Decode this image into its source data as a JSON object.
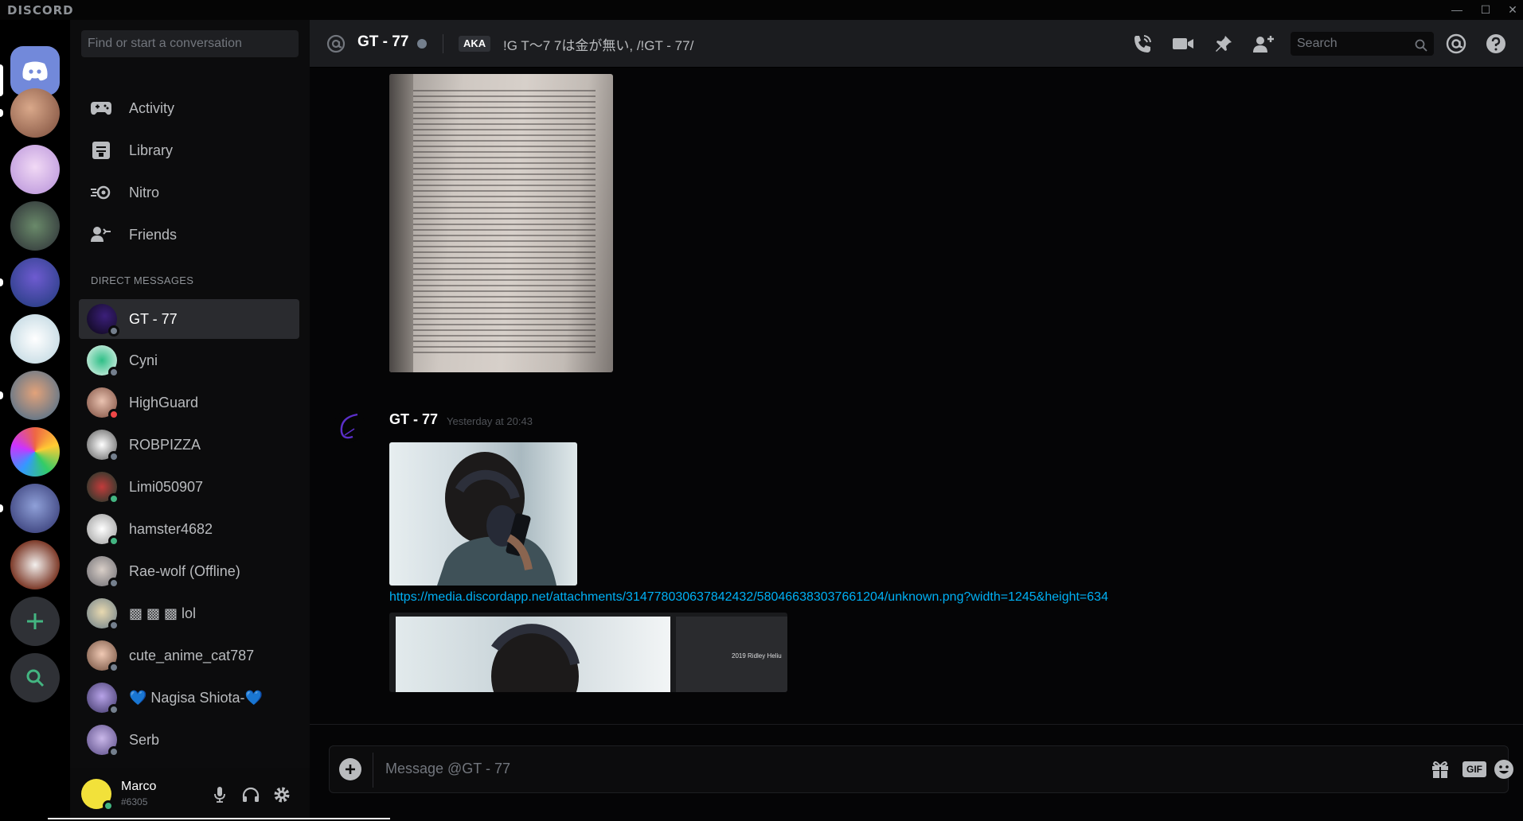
{
  "window": {
    "brand": "DISCORD"
  },
  "sidebar": {
    "search_placeholder": "Find or start a conversation",
    "nav": [
      {
        "label": "Activity",
        "icon": "gamepad-icon"
      },
      {
        "label": "Library",
        "icon": "library-icon"
      },
      {
        "label": "Nitro",
        "icon": "nitro-icon"
      },
      {
        "label": "Friends",
        "icon": "friends-icon"
      }
    ],
    "section_title": "DIRECT MESSAGES",
    "dms": [
      {
        "name": "GT - 77",
        "status": "offline",
        "active": true
      },
      {
        "name": "Cyni",
        "status": "offline"
      },
      {
        "name": "HighGuard",
        "status": "dnd"
      },
      {
        "name": "ROBPIZZA",
        "status": "offline"
      },
      {
        "name": "Limi050907",
        "status": "online"
      },
      {
        "name": "hamster4682",
        "status": "online"
      },
      {
        "name": "Rae-wolf (Offline)",
        "status": "offline"
      },
      {
        "name": "▩ ▩ ▩ lol",
        "status": "offline"
      },
      {
        "name": "cute_anime_cat787",
        "status": "offline"
      },
      {
        "name": "💙 Nagisa Shiota-💙",
        "status": "offline"
      },
      {
        "name": "Serb",
        "status": "offline"
      }
    ],
    "user": {
      "name": "Marco",
      "tag": "#6305"
    }
  },
  "header": {
    "channel_name": "GT - 77",
    "aka_label": "AKA",
    "aka_text": "!G T～7 7は金が無い, /!GT - 77/",
    "search_placeholder": "Search"
  },
  "messages": {
    "author": "GT - 77",
    "timestamp": "Yesterday at 20:43",
    "link": "https://media.discordapp.net/attachments/314778030637842432/580466383037661204/unknown.png?width=1245&height=634",
    "embed_caption": "2019 Ridley Heliu"
  },
  "composer": {
    "placeholder": "Message @GT - 77",
    "gif_label": "GIF"
  },
  "colors": {
    "online": "#43b581",
    "offline": "#747f8d",
    "dnd": "#f04747",
    "link": "#00b0f4",
    "blurple": "#7289da",
    "add_server": "#43b581"
  }
}
